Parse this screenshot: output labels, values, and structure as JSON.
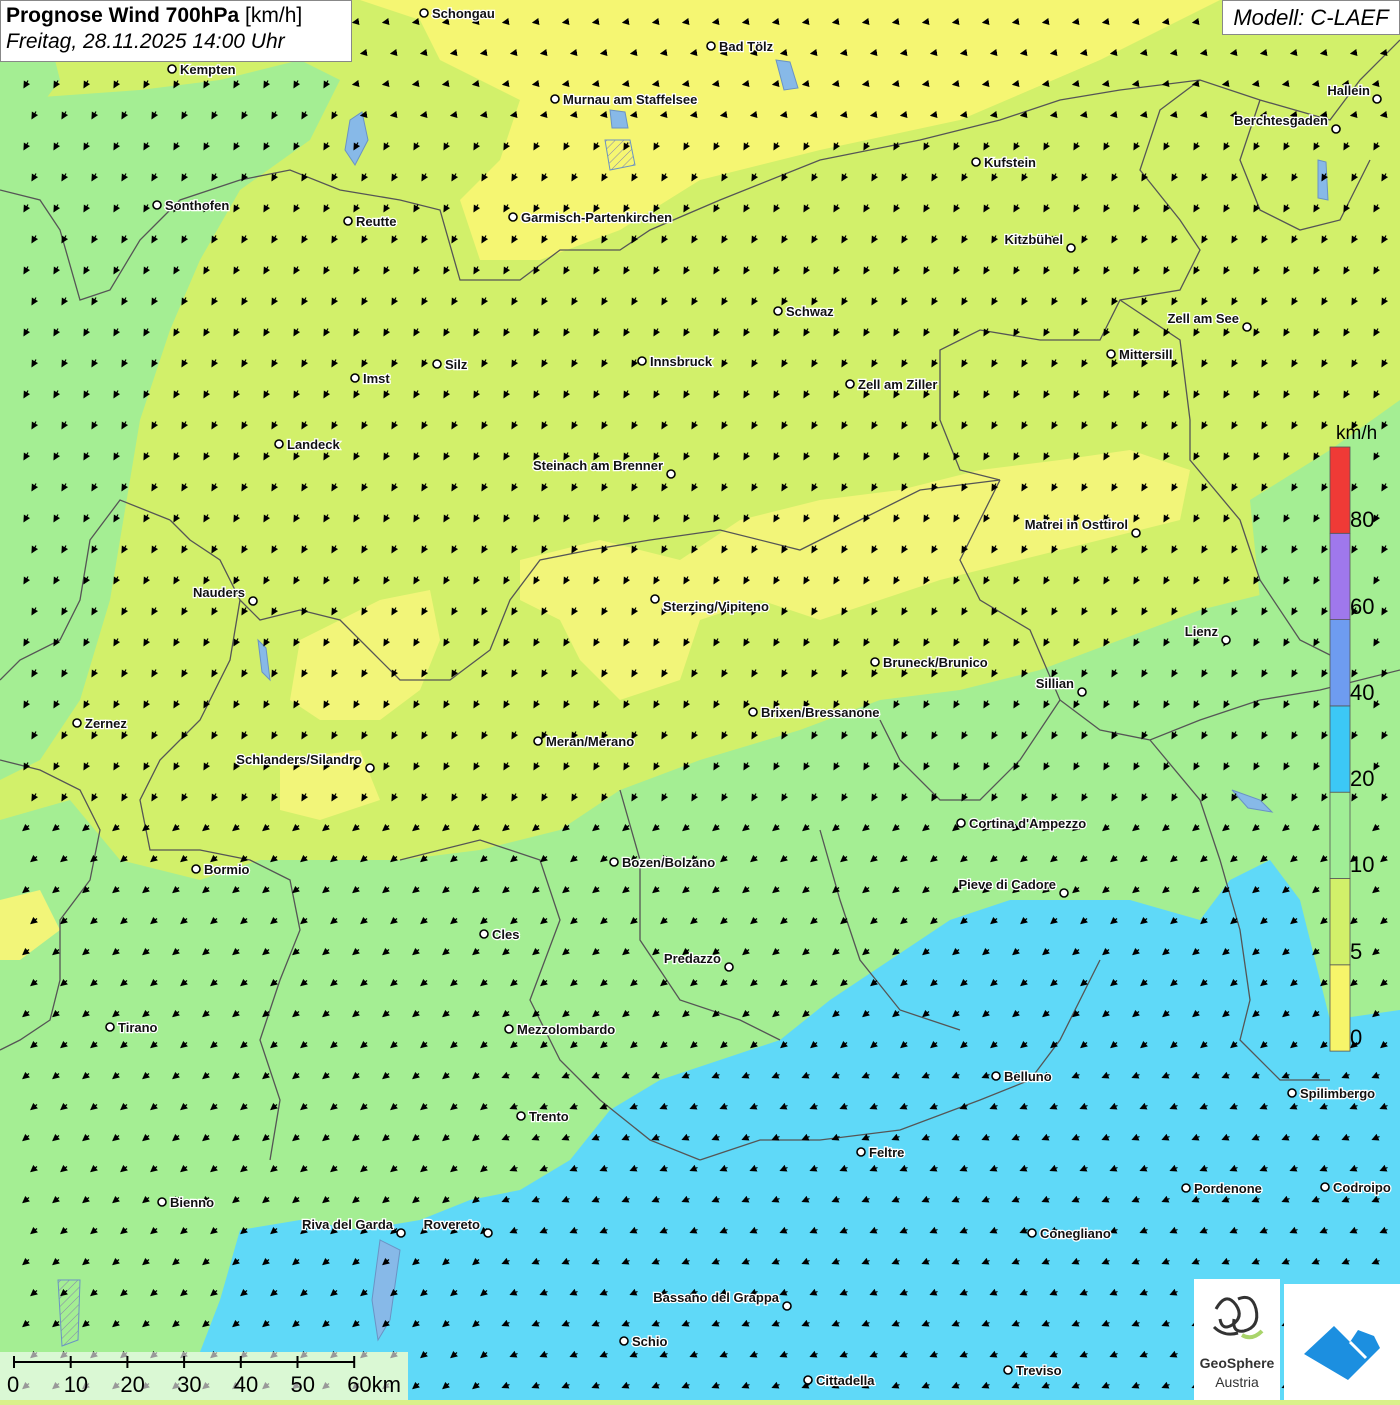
{
  "header": {
    "title_bold": "Prognose Wind 700hPa",
    "title_unit": "[km/h]",
    "date": "Freitag, 28.11.2025 14:00 Uhr",
    "model": "Modell: C-LAEF"
  },
  "legend": {
    "unit": "km/h",
    "labels": [
      "0",
      "5",
      "10",
      "20",
      "40",
      "60",
      "80"
    ],
    "colors": [
      "#f7f56a",
      "#d2f06a",
      "#a0ee96",
      "#3cc8f6",
      "#6e9cf0",
      "#9f78ec",
      "#ef3a36"
    ]
  },
  "scale_bar": {
    "labels": [
      "0",
      "10",
      "20",
      "30",
      "40",
      "50",
      "60km"
    ]
  },
  "cities": [
    {
      "name": "Schongau"
    },
    {
      "name": "Bad Tölz"
    },
    {
      "name": "Kempten"
    },
    {
      "name": "Murnau am Staffelsee"
    },
    {
      "name": "Hallein"
    },
    {
      "name": "Berchtesgaden"
    },
    {
      "name": "Kufstein"
    },
    {
      "name": "Sonthofen"
    },
    {
      "name": "Reutte"
    },
    {
      "name": "Garmisch-Partenkirchen"
    },
    {
      "name": "Kitzbühel"
    },
    {
      "name": "Schwaz"
    },
    {
      "name": "Zell am See"
    },
    {
      "name": "Mittersill"
    },
    {
      "name": "Imst"
    },
    {
      "name": "Silz"
    },
    {
      "name": "Innsbruck"
    },
    {
      "name": "Zell am Ziller"
    },
    {
      "name": "Landeck"
    },
    {
      "name": "Steinach am Brenner"
    },
    {
      "name": "Matrei in Osttirol"
    },
    {
      "name": "Nauders"
    },
    {
      "name": "Sterzing/Vipiteno"
    },
    {
      "name": "Lienz"
    },
    {
      "name": "Bruneck/Brunico"
    },
    {
      "name": "Sillian"
    },
    {
      "name": "Zernez"
    },
    {
      "name": "Brixen/Bressanone"
    },
    {
      "name": "Meran/Merano"
    },
    {
      "name": "Schlanders/Silandro"
    },
    {
      "name": "Cortina d'Ampezzo"
    },
    {
      "name": "Bormio"
    },
    {
      "name": "Bozen/Bolzano"
    },
    {
      "name": "Pieve di Cadore"
    },
    {
      "name": "Cles"
    },
    {
      "name": "Predazzo"
    },
    {
      "name": "Tirano"
    },
    {
      "name": "Mezzolombardo"
    },
    {
      "name": "Belluno"
    },
    {
      "name": "Spilimbergo"
    },
    {
      "name": "Trento"
    },
    {
      "name": "Feltre"
    },
    {
      "name": "Pordenone"
    },
    {
      "name": "Codroipo"
    },
    {
      "name": "Bienno"
    },
    {
      "name": "Riva del Garda"
    },
    {
      "name": "Rovereto"
    },
    {
      "name": "Conegliano"
    },
    {
      "name": "Bassano del Grappa"
    },
    {
      "name": "Schio"
    },
    {
      "name": "Treviso"
    },
    {
      "name": "Cittadella"
    }
  ],
  "logo": {
    "line1": "GeoSphere",
    "line2": "Austria"
  },
  "colors": {
    "wind_0_5": "#f7f56a",
    "wind_5_10": "#d2f06a",
    "wind_10_20": "#a0ee96",
    "wind_20_40": "#5fd9f8"
  }
}
